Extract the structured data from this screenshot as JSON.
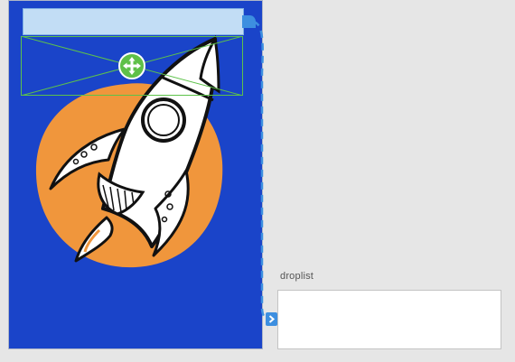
{
  "canvas": {
    "background": "#e6e6e6"
  },
  "artboard": {
    "background": "#1a44c9",
    "illustration": "rocket-over-orange-sun",
    "sun_color": "#f0963c",
    "hotspot_color": "#c2ddf5",
    "selection_color": "#5dc24a"
  },
  "controls": {
    "move_handle_icon": "move-arrows-icon",
    "link_connector_icon": "link-connector-icon",
    "link_target_icon": "chevron-right-icon",
    "link_color": "#3d8fe0"
  },
  "droplist": {
    "label": "droplist"
  }
}
